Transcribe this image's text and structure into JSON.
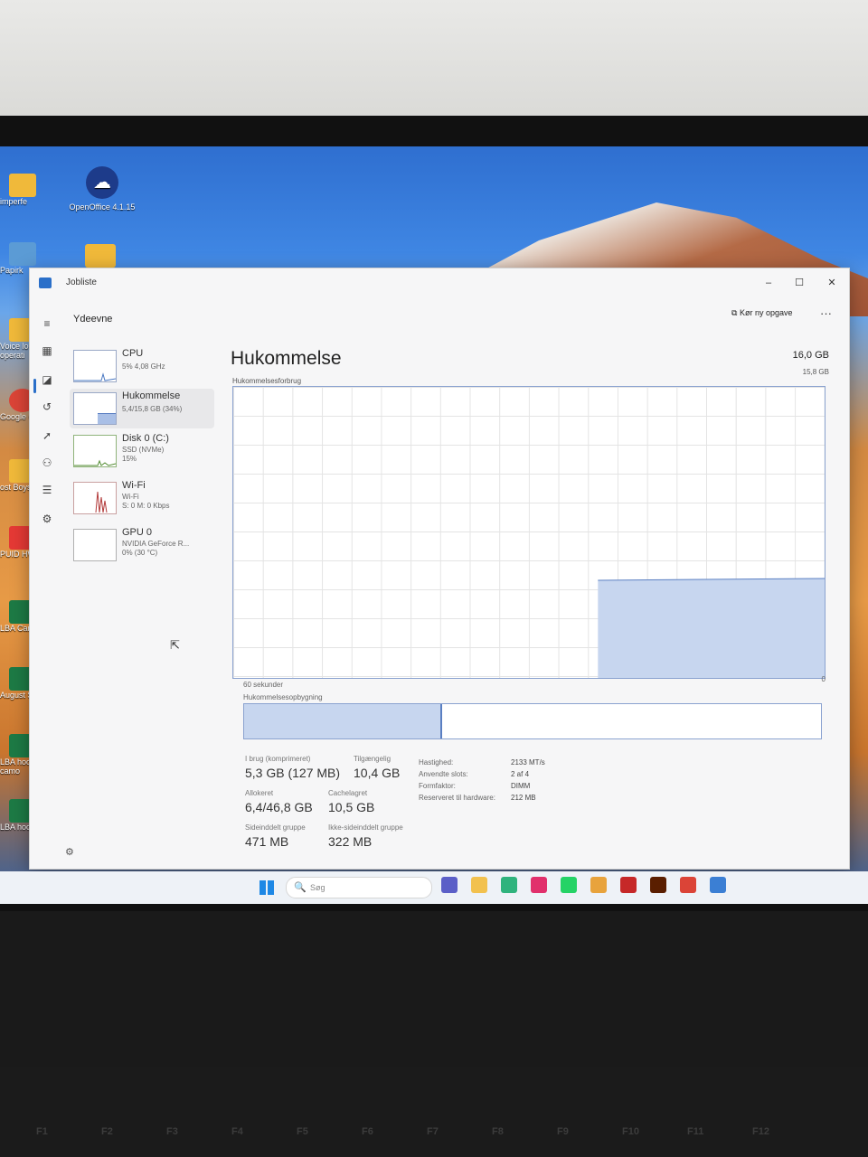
{
  "desktop": {
    "icons": [
      {
        "label": "imperfe",
        "color": "#f0b93a"
      },
      {
        "label": "Papirk",
        "color": "#5b9bd5"
      },
      {
        "label": "Voice lo operati",
        "color": "#f0b93a"
      },
      {
        "label": "Google Ch",
        "color": "#db4437"
      },
      {
        "label": "ost Boys",
        "color": "#f0b93a"
      },
      {
        "label": "PUID HWI",
        "color": "#e53935"
      },
      {
        "label": "LBA Camo j",
        "color": "#1d7a45"
      },
      {
        "label": "August Socc",
        "color": "#1d7a45"
      },
      {
        "label": "LBA hoodi camo",
        "color": "#1d7a45"
      },
      {
        "label": "LBA hoodi",
        "color": "#1d7a45"
      }
    ],
    "openoffice_label": "OpenOffice 4.1.15"
  },
  "window": {
    "title": "Jobliste",
    "minimize": "–",
    "maximize": "☐",
    "close": "✕",
    "page_label": "Ydeevne",
    "run_task_icon": "⧉",
    "run_task_label": "Kør ny opgave",
    "more_label": "···"
  },
  "rail": {
    "menu": "≡",
    "processes": "▦",
    "performance": "◪",
    "history": "↺",
    "startup": "➚",
    "users": "⚇",
    "details": "☰",
    "services": "⚙"
  },
  "sidebar": [
    {
      "name": "CPU",
      "sub1": "5% 4,08 GHz",
      "sub2": "",
      "sub3": ""
    },
    {
      "name": "Hukommelse",
      "sub1": "5,4/15,8 GB (34%)",
      "sub2": "",
      "sub3": ""
    },
    {
      "name": "Disk 0 (C:)",
      "sub1": "SSD (NVMe)",
      "sub2": "15%",
      "sub3": ""
    },
    {
      "name": "Wi-Fi",
      "sub1": "Wi-Fi",
      "sub2": "S: 0 M: 0 Kbps",
      "sub3": ""
    },
    {
      "name": "GPU 0",
      "sub1": "NVIDIA GeForce R...",
      "sub2": "0% (30 °C)",
      "sub3": ""
    }
  ],
  "memory": {
    "title": "Hukommelse",
    "total": "16,0 GB",
    "usage_label": "Hukommelsesforbrug",
    "usage_max": "15,8 GB",
    "axis_left": "60 sekunder",
    "axis_right": "0",
    "composition_label": "Hukommelsesopbygning",
    "composition_used_fraction": 0.34,
    "stats": {
      "in_use_label": "I brug (komprimeret)",
      "in_use_value": "5,3 GB (127 MB)",
      "available_label": "Tilgængelig",
      "available_value": "10,4 GB",
      "committed_label": "Allokeret",
      "committed_value": "6,4/46,8 GB",
      "cached_label": "Cachelagret",
      "cached_value": "10,5 GB",
      "paged_label": "Sideinddelt gruppe",
      "paged_value": "471 MB",
      "nonpaged_label": "Ikke-sideinddelt gruppe",
      "nonpaged_value": "322 MB"
    },
    "properties": [
      {
        "label": "Hastighed:",
        "value": "2133 MT/s"
      },
      {
        "label": "Anvendte slots:",
        "value": "2 af 4"
      },
      {
        "label": "Formfaktor:",
        "value": "DIMM"
      },
      {
        "label": "Reserveret til hardware:",
        "value": "212 MB"
      }
    ]
  },
  "chart_data": {
    "type": "area",
    "title": "Hukommelsesforbrug",
    "xlabel": "60 sekunder",
    "ylabel": "",
    "ylim": [
      0,
      15.8
    ],
    "xlim": [
      60,
      0
    ],
    "x": [
      60,
      24,
      23,
      0
    ],
    "values": [
      null,
      null,
      5.3,
      5.4
    ],
    "color": "#c7d6ef",
    "line_color": "#5a7fc2"
  },
  "taskbar": {
    "search_icon": "🔍",
    "search_placeholder": "Søg",
    "apps": [
      {
        "name": "teams-icon",
        "color": "#5b5fc7"
      },
      {
        "name": "file-explorer-icon",
        "color": "#f2c14e"
      },
      {
        "name": "edge-icon",
        "color": "#2fb37d"
      },
      {
        "name": "instagram-icon",
        "color": "#e1306c"
      },
      {
        "name": "whatsapp-icon",
        "color": "#25d366"
      },
      {
        "name": "photos-icon",
        "color": "#e8a33c"
      },
      {
        "name": "app-icon",
        "color": "#c62828"
      },
      {
        "name": "illustrator-icon",
        "color": "#5a1e00"
      },
      {
        "name": "chrome-icon",
        "color": "#db4437"
      },
      {
        "name": "task-manager-icon",
        "color": "#3b7fd4"
      }
    ]
  },
  "keyboard": {
    "keys": [
      "F1",
      "F2",
      "F3",
      "F4",
      "F5",
      "F6",
      "F7",
      "F8",
      "F9",
      "F10",
      "F11",
      "F12"
    ]
  }
}
